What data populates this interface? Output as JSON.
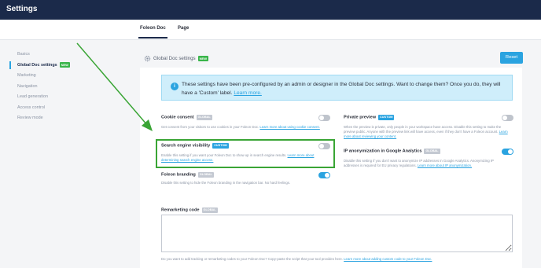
{
  "app_title": "Settings",
  "tabs": [
    {
      "label": "Foleon Doc"
    },
    {
      "label": "Page"
    }
  ],
  "sidebar": {
    "items": [
      {
        "label": "Basics"
      },
      {
        "label": "Global Doc settings",
        "badge": "NEW"
      },
      {
        "label": "Marketing"
      },
      {
        "label": "Navigation"
      },
      {
        "label": "Lead generation"
      },
      {
        "label": "Access control"
      },
      {
        "label": "Review mode"
      }
    ]
  },
  "header": {
    "title": "Global Doc settings",
    "badge": "NEW",
    "reset_label": "Reset"
  },
  "info": {
    "icon": "info-icon",
    "text": "These settings have been pre-configured by an admin or designer in the Global Doc settings. Want to change them? Once you do, they will have a 'Custom' label.",
    "link": "Learn more."
  },
  "settings": {
    "cookie": {
      "name": "Cookie consent",
      "tag": "GLOBAL",
      "state": "off",
      "desc": "Get consent from your visitors to use cookies in your Foleon Doc.",
      "link": "Learn more about using cookie consent."
    },
    "private": {
      "name": "Private preview",
      "tag": "CUSTOM",
      "state": "off",
      "desc": "When the preview is private, only people in your workspace have access. Disable this setting to make the preview public. Anyone with the preview link will have access, even if they don't have a Foleon account.",
      "link": "Learn more about reviewing your content."
    },
    "search": {
      "name": "Search engine visibility",
      "tag": "CUSTOM",
      "state": "off",
      "desc": "Enable this setting if you want your Foleon Doc to show up in search engine results.",
      "link": "Learn more about determining search engine access."
    },
    "ip": {
      "name": "IP anonymization in Google Analytics",
      "tag": "GLOBAL",
      "state": "on",
      "desc": "Disable this setting if you don't want to anonymize IP addresses in Google Analytics. Anonymizing IP addresses is required for EU privacy regulations.",
      "link": "Learn more about IP anonymization."
    },
    "branding": {
      "name": "Foleon branding",
      "tag": "GLOBAL",
      "state": "on",
      "desc": "Disable this setting to hide the Foleon branding in the navigation bar. No hard feelings."
    }
  },
  "remarketing": {
    "name": "Remarketing code",
    "tag": "GLOBAL",
    "value": "",
    "desc": "Do you want to add tracking or remarketing codes to your Foleon Doc? Copy-paste the script that your tool provides here.",
    "link": "Learn more about adding custom code to your Foleon Doc."
  },
  "colors": {
    "topbar": "#1b2a4a",
    "accent": "#2aa3e0",
    "highlight": "#3aa535",
    "new_badge": "#39b54a"
  }
}
